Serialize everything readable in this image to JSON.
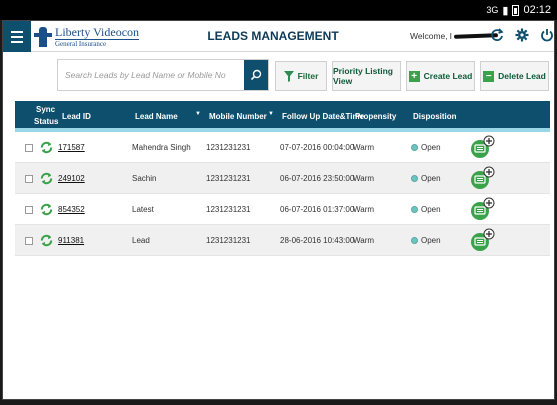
{
  "status_bar": {
    "signal": "3G",
    "time": "02:12"
  },
  "header": {
    "brand_line1": "Liberty Videocon",
    "brand_line2": "General Insurance",
    "title": "LEADS MANAGEMENT",
    "welcome": "Welcome, ",
    "welcome_initial": "I"
  },
  "toolbar": {
    "search_placeholder": "Search Leads by Lead Name or Mobile No",
    "filter_label": "Filter",
    "priority_label": "Priority Listing View",
    "create_label": "Create Lead",
    "delete_label": "Delete Lead"
  },
  "table": {
    "columns": {
      "sync_line1": "Sync",
      "sync_line2": "Status",
      "lead_id": "Lead ID",
      "lead_name": "Lead Name",
      "mobile": "Mobile Number",
      "followup": "Follow Up Date&Time",
      "propensity": "Propensity",
      "disposition": "Disposition"
    },
    "rows": [
      {
        "lead_id": "171587",
        "name": "Mahendra Singh",
        "mobile": "1231231231",
        "followup": "07-07-2016 00:04:00",
        "propensity": "Warm",
        "disposition": "Open"
      },
      {
        "lead_id": "249102",
        "name": "Sachin",
        "mobile": "1231231231",
        "followup": "06-07-2016 23:50:00",
        "propensity": "Warm",
        "disposition": "Open"
      },
      {
        "lead_id": "854352",
        "name": "Latest",
        "mobile": "1231231231",
        "followup": "06-07-2016 01:37:00",
        "propensity": "Warm",
        "disposition": "Open"
      },
      {
        "lead_id": "911381",
        "name": "Lead",
        "mobile": "1231231231",
        "followup": "28-06-2016 10:43:00",
        "propensity": "Warm",
        "disposition": "Open"
      }
    ]
  },
  "colors": {
    "primary": "#0d4f6c",
    "accent_green": "#3aa24a",
    "header_underline": "#9bd5e8",
    "status_open": "#6cc4c0"
  }
}
